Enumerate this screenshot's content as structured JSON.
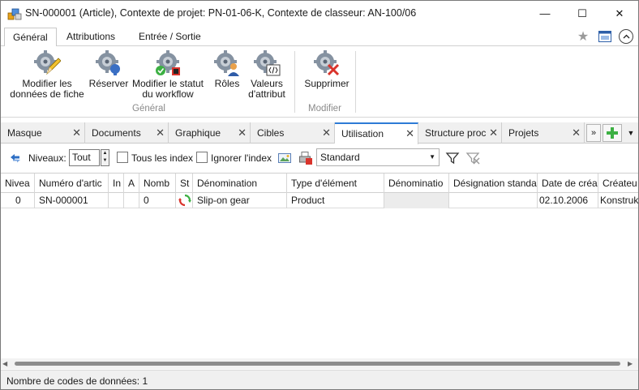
{
  "window": {
    "title": "SN-000001 (Article), Contexte de projet: PN-01-06-K, Contexte de classeur: AN-100/06",
    "min_glyph": "—",
    "max_glyph": "☐",
    "close_glyph": "✕"
  },
  "ribbon": {
    "tabs": [
      "Général",
      "Attributions",
      "Entrée / Sortie"
    ],
    "active_tab": "Général",
    "groups": [
      {
        "label": "Général",
        "buttons": [
          {
            "line1": "Modifier les",
            "line2": "données de fiche",
            "icon": "edit-gear-icon"
          },
          {
            "line1": "Réserver",
            "line2": "",
            "icon": "reserve-gear-icon"
          },
          {
            "line1": "Modifier le statut",
            "line2": "du workflow",
            "icon": "workflow-gear-icon"
          },
          {
            "line1": "Rôles",
            "line2": "",
            "icon": "roles-gear-icon"
          },
          {
            "line1": "Valeurs",
            "line2": "d'attribut",
            "icon": "attribute-gear-icon"
          }
        ]
      },
      {
        "label": "Modifier",
        "buttons": [
          {
            "line1": "Supprimer",
            "line2": "",
            "icon": "delete-gear-icon"
          }
        ]
      }
    ]
  },
  "doc_tabs": {
    "items": [
      "Masque",
      "Documents",
      "Graphique",
      "Cibles",
      "Utilisation",
      "Structure proc",
      "Projets"
    ],
    "active": "Utilisation",
    "close_glyph": "✕",
    "more_glyph": "»",
    "dropdown_glyph": "▼"
  },
  "toolbar": {
    "levels_label": "Niveaux:",
    "levels_value": "Tout",
    "all_index_label": "Tous les index",
    "ignore_index_label": "Ignorer l'index",
    "view_select": "Standard"
  },
  "grid": {
    "columns": [
      "Nivea",
      "Numéro d'artic",
      "In",
      "A",
      "Nomb",
      "St",
      "Dénomination",
      "Type d'élément",
      "Dénominatio",
      "Désignation standa",
      "Date de créa",
      "Créateu"
    ],
    "rows": [
      [
        "0",
        "SN-000001",
        "",
        "",
        "0",
        "",
        "Slip-on gear",
        "Product",
        "",
        "",
        "02.10.2006",
        "Konstruk"
      ]
    ]
  },
  "statusbar": {
    "text": "Nombre de codes de données: 1"
  },
  "colors": {
    "accent": "#2e7bd6",
    "gear": "#7d8896",
    "add_green": "#3cb043",
    "delete_red": "#d9332b"
  }
}
